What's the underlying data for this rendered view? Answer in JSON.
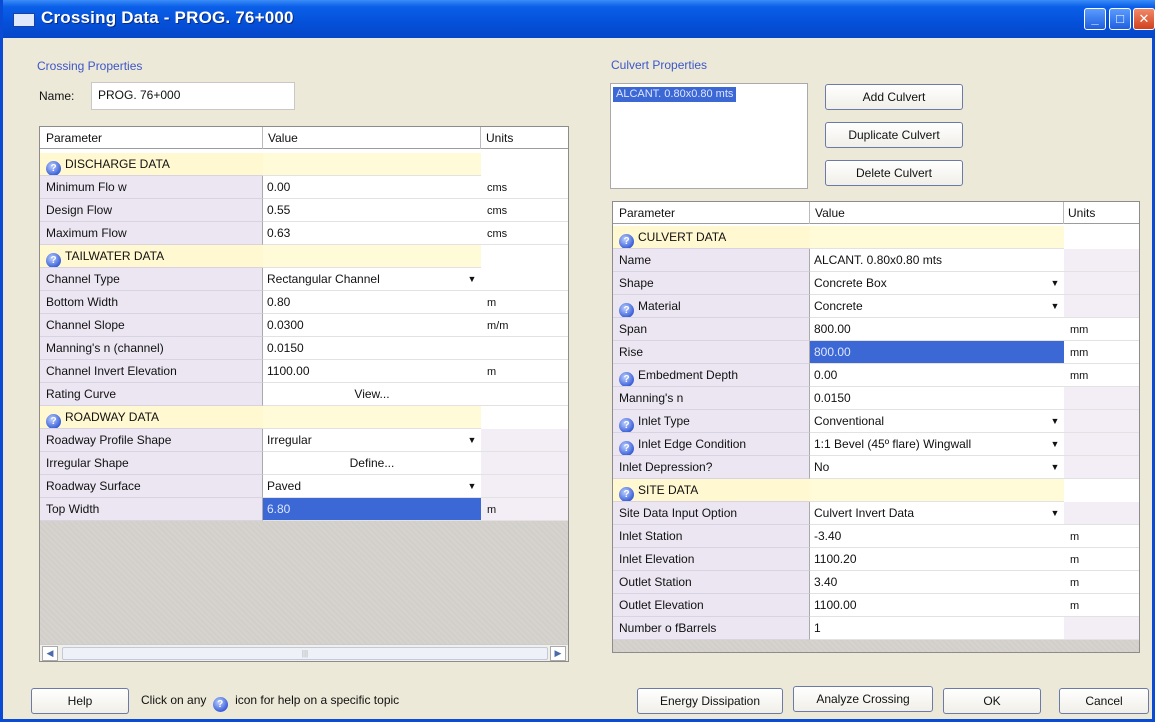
{
  "window": {
    "title": "Crossing Data - PROG. 76+000"
  },
  "crossing": {
    "section_title": "Crossing Properties",
    "name_label": "Name:",
    "name_value": "PROG. 76+000"
  },
  "left_grid": {
    "headers": {
      "param": "Parameter",
      "value": "Value",
      "units": "Units"
    },
    "discharge_title": "DISCHARGE DATA",
    "min_flow": {
      "param": "Minimum Flo w",
      "value": "0.00",
      "units": "cms"
    },
    "design_flow": {
      "param": "Design Flow",
      "value": "0.55",
      "units": "cms"
    },
    "max_flow": {
      "param": "Maximum Flow",
      "value": "0.63",
      "units": "cms"
    },
    "tailwater_title": "TAILWATER DATA",
    "channel_type": {
      "param": "Channel Type",
      "value": "Rectangular Channel",
      "units": ""
    },
    "bottom_width": {
      "param": "Bottom Width",
      "value": "0.80",
      "units": "m"
    },
    "channel_slope": {
      "param": "Channel Slope",
      "value": "0.0300",
      "units": "m/m"
    },
    "mannings_channel": {
      "param": "Manning's n (channel)",
      "value": "0.0150",
      "units": ""
    },
    "channel_invert": {
      "param": "Channel Invert Elevation",
      "value": "1100.00",
      "units": "m"
    },
    "rating_curve": {
      "param": "Rating Curve",
      "value": "View...",
      "units": ""
    },
    "roadway_title": "ROADWAY DATA",
    "roadway_profile": {
      "param": "Roadway Profile Shape",
      "value": "Irregular",
      "units": ""
    },
    "irregular_shape": {
      "param": "Irregular Shape",
      "value": "Define...",
      "units": ""
    },
    "roadway_surface": {
      "param": "Roadway Surface",
      "value": "Paved",
      "units": ""
    },
    "top_width": {
      "param": "Top Width",
      "value": "6.80",
      "units": "m"
    }
  },
  "culvert": {
    "section_title": "Culvert Properties",
    "list_items": [
      "ALCANT. 0.80x0.80 mts"
    ],
    "add_label": "Add Culvert",
    "duplicate_label": "Duplicate Culvert",
    "delete_label": "Delete Culvert"
  },
  "right_grid": {
    "headers": {
      "param": "Parameter",
      "value": "Value",
      "units": "Units"
    },
    "culvert_title": "CULVERT DATA",
    "name": {
      "param": "Name",
      "value": "ALCANT. 0.80x0.80 mts",
      "units": ""
    },
    "shape": {
      "param": "Shape",
      "value": "Concrete Box",
      "units": ""
    },
    "material": {
      "param": "Material",
      "value": "Concrete",
      "units": ""
    },
    "span": {
      "param": "Span",
      "value": "800.00",
      "units": "mm"
    },
    "rise": {
      "param": "Rise",
      "value": "800.00",
      "units": "mm"
    },
    "embedment": {
      "param": "Embedment Depth",
      "value": "0.00",
      "units": "mm"
    },
    "mannings": {
      "param": "Manning's n",
      "value": "0.0150",
      "units": ""
    },
    "inlet_type": {
      "param": "Inlet Type",
      "value": "Conventional",
      "units": ""
    },
    "inlet_edge": {
      "param": "Inlet Edge Condition",
      "value": "1:1 Bevel (45º flare) Wingwall",
      "units": ""
    },
    "inlet_depression": {
      "param": "Inlet Depression?",
      "value": "No",
      "units": ""
    },
    "site_title": "SITE DATA",
    "site_input": {
      "param": "Site Data Input Option",
      "value": "Culvert Invert Data",
      "units": ""
    },
    "inlet_station": {
      "param": "Inlet Station",
      "value": "-3.40",
      "units": "m"
    },
    "inlet_elevation": {
      "param": "Inlet Elevation",
      "value": "1100.20",
      "units": "m"
    },
    "outlet_station": {
      "param": "Outlet Station",
      "value": "3.40",
      "units": "m"
    },
    "outlet_elevation": {
      "param": "Outlet Elevation",
      "value": "1100.00",
      "units": "m"
    },
    "barrels": {
      "param": "Number o fBarrels",
      "value": "1",
      "units": ""
    }
  },
  "footer": {
    "help_label": "Help",
    "hint_before": "Click on any",
    "hint_after": "icon for help on a specific topic",
    "energy_label": "Energy Dissipation",
    "analyze_label": "Analyze Crossing",
    "ok_label": "OK",
    "cancel_label": "Cancel"
  },
  "icons": {
    "help": "question-circle-icon",
    "dropdown": "chevron-down-icon",
    "scroll_left": "arrow-left-icon",
    "scroll_right": "arrow-right-icon"
  },
  "colors": {
    "titlebar": "#0550d9",
    "section_header_bg": "#fff8d0",
    "selection": "#3b68d4",
    "param_bg": "#ebe6f2"
  }
}
